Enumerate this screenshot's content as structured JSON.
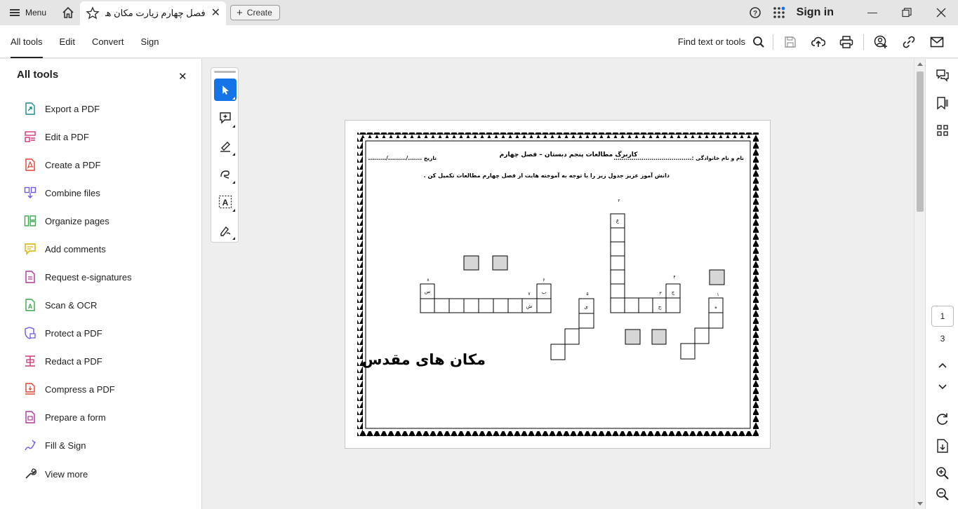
{
  "titlebar": {
    "menu_label": "Menu",
    "tab_title": "فصل چهارم زیارت مکان های..",
    "create_label": "Create",
    "sign_in": "Sign in"
  },
  "toolbar": {
    "tabs": [
      {
        "label": "All tools",
        "active": true
      },
      {
        "label": "Edit",
        "active": false
      },
      {
        "label": "Convert",
        "active": false
      },
      {
        "label": "Sign",
        "active": false
      }
    ],
    "find_label": "Find text or tools"
  },
  "left_panel": {
    "title": "All tools",
    "items": [
      {
        "label": "Export a PDF",
        "icon": "export-pdf-icon",
        "color": "#1c8c88"
      },
      {
        "label": "Edit a PDF",
        "icon": "edit-pdf-icon",
        "color": "#d1357d"
      },
      {
        "label": "Create a PDF",
        "icon": "create-pdf-icon",
        "color": "#e2402f"
      },
      {
        "label": "Combine files",
        "icon": "combine-files-icon",
        "color": "#6c5ce7"
      },
      {
        "label": "Organize pages",
        "icon": "organize-pages-icon",
        "color": "#3aa64a"
      },
      {
        "label": "Add comments",
        "icon": "add-comments-icon",
        "color": "#d8b000"
      },
      {
        "label": "Request e-signatures",
        "icon": "request-esignatures-icon",
        "color": "#b3339d"
      },
      {
        "label": "Scan & OCR",
        "icon": "scan-ocr-icon",
        "color": "#3aa64a"
      },
      {
        "label": "Protect a PDF",
        "icon": "protect-pdf-icon",
        "color": "#6c5ce7"
      },
      {
        "label": "Redact a PDF",
        "icon": "redact-pdf-icon",
        "color": "#d1357d"
      },
      {
        "label": "Compress a PDF",
        "icon": "compress-pdf-icon",
        "color": "#e2402f"
      },
      {
        "label": "Prepare a form",
        "icon": "prepare-form-icon",
        "color": "#b3339d"
      },
      {
        "label": "Fill & Sign",
        "icon": "fill-sign-icon",
        "color": "#6c5ce7"
      },
      {
        "label": "View more",
        "icon": "view-more-icon",
        "color": "#333333"
      }
    ]
  },
  "document": {
    "header_title": "کاربرگ مطالعات پنجم دبستان – فصل چهارم",
    "name_label": "نام و نام خانوادگی :.......................................",
    "date_label": "تاریخ  ......./........./.........",
    "instruction": "دانش آموز عزیز جدول زیر را با توجه به آموخته هایت از فصل چهارم مطالعات تکمیل کن .",
    "big_title": "مکان های مقدس",
    "cell_letters": {
      "c2": "ع",
      "c3": "ح",
      "c3b": "ج",
      "c4": "ج",
      "c1": "ه",
      "c5": "ی",
      "c6": "ب",
      "c7": "ش",
      "c8": "س"
    },
    "clue_numbers": {
      "n1": "۱",
      "n2": "۲",
      "n3": "۳",
      "n4": "۴",
      "n5": "۵",
      "n6": "۶",
      "n7": "۷",
      "n8": "۸"
    }
  },
  "page_nav": {
    "current": "1",
    "total": "3"
  },
  "colors": {
    "accent": "#1473e6",
    "titlebar_bg": "#e5e5e5",
    "doc_bg": "#eeeeee"
  }
}
